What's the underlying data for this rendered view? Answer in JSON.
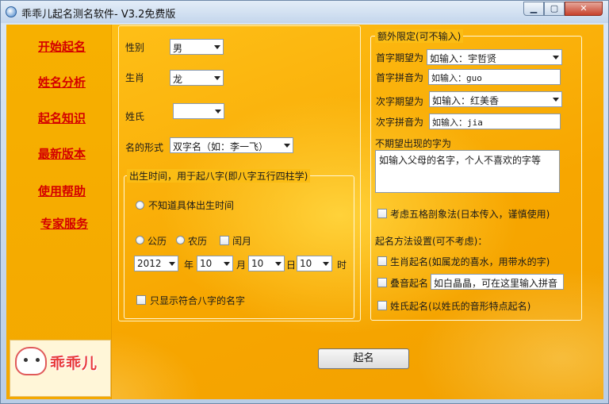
{
  "window": {
    "title": "乖乖儿起名测名软件- V3.2免费版"
  },
  "sidebar": {
    "items": [
      {
        "label": "开始起名"
      },
      {
        "label": "姓名分析"
      },
      {
        "label": "起名知识"
      },
      {
        "label": "最新版本"
      },
      {
        "label": "使用帮助"
      },
      {
        "label": "专家服务"
      }
    ],
    "logo_text": "乖乖儿"
  },
  "form": {
    "gender_label": "性别",
    "gender_value": "男",
    "zodiac_label": "生肖",
    "zodiac_value": "龙",
    "surname_label": "姓氏",
    "surname_value": "",
    "name_form_label": "名的形式",
    "name_form_value": "双字名（如：李一飞）"
  },
  "birth": {
    "legend": "出生时间，用于起八字(即八字五行四柱学)",
    "unknown_label": "不知道具体出生时间",
    "solar_label": "公历",
    "lunar_label": "农历",
    "leap_label": "闰月",
    "year_value": "2012",
    "year_unit": "年",
    "month_value": "10",
    "month_unit": "月",
    "day_value": "10",
    "day_unit": "日",
    "hour_value": "10",
    "hour_unit": "时",
    "bazi_only_label": "只显示符合八字的名字"
  },
  "extra": {
    "legend": "额外限定(可不输入)",
    "first_char_label": "首字期望为",
    "first_char_value": "如输入：宇哲贤",
    "first_pinyin_label": "首字拼音为",
    "first_pinyin_value": "如输入：guo",
    "second_char_label": "次字期望为",
    "second_char_value": "如输入：红美香",
    "second_pinyin_label": "次字拼音为",
    "second_pinyin_value": "如输入：jia",
    "unwanted_label": "不期望出现的字为",
    "unwanted_value": "如输入父母的名字，个人不喜欢的字等",
    "wuge_label": "考虑五格剖象法(日本传入，谨慎使用)",
    "method_title": "起名方法设置(可不考虑)：",
    "zodiac_method_label": "生肖起名(如属龙的喜水，用带水的字)",
    "overlap_label": "叠音起名",
    "overlap_value": "如白晶晶，可在这里输入拼音",
    "surname_method_label": "姓氏起名(以姓氏的音形特点起名)"
  },
  "action": {
    "submit_label": "起名"
  },
  "colors": {
    "accent_red": "#d40000",
    "background_orange": "#f7a600"
  }
}
